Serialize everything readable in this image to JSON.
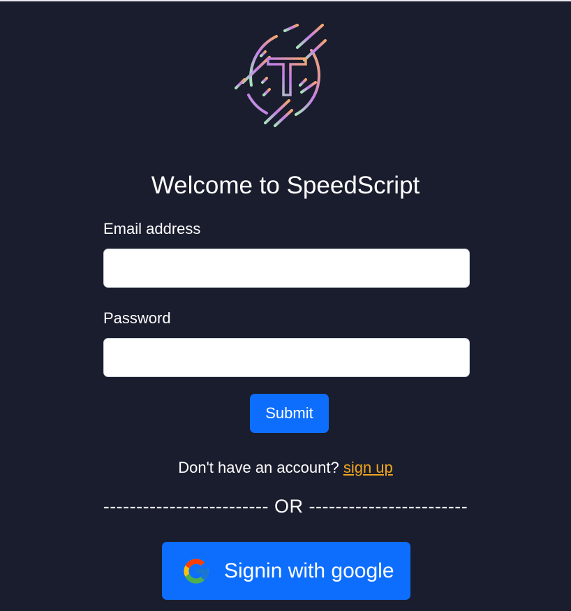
{
  "page": {
    "heading": "Welcome to SpeedScript"
  },
  "logo": {
    "icon": "speedscript-logo-icon",
    "letter": "T",
    "colors": [
      "#a8e6b8",
      "#c47ee8",
      "#f5a86a"
    ]
  },
  "form": {
    "email_label": "Email address",
    "email_value": "",
    "password_label": "Password",
    "password_value": "",
    "submit_label": "Submit"
  },
  "signup": {
    "prompt": "Don't have an account?",
    "link_label": "sign up"
  },
  "divider": {
    "text": "------------------------- OR ------------------------"
  },
  "google": {
    "icon": "google-icon",
    "label": "Signin with google"
  },
  "colors": {
    "background": "#1a1d2e",
    "primary": "#0d6efd",
    "link": "#f0a51e"
  }
}
